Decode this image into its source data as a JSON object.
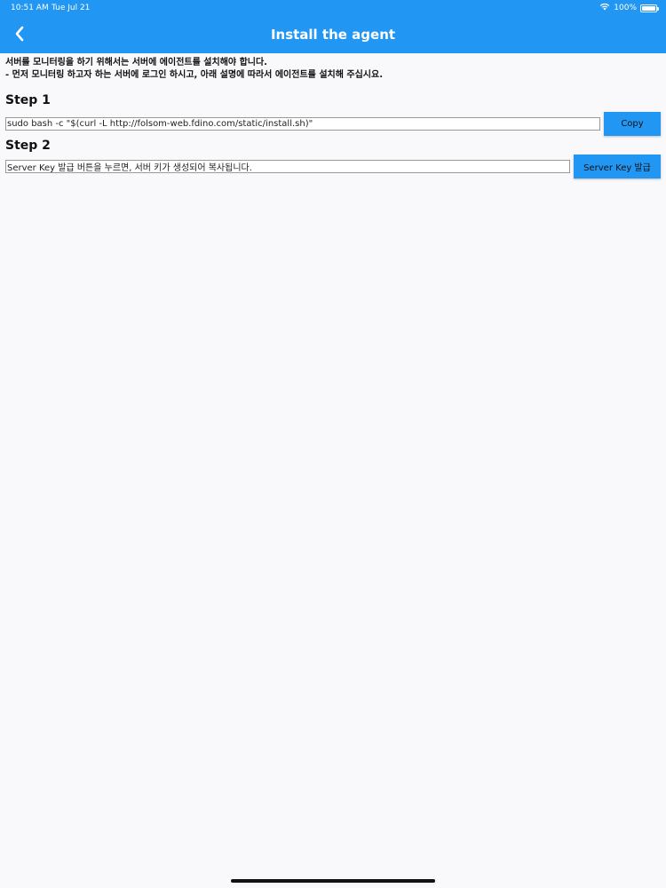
{
  "status_bar": {
    "time": "10:51 AM",
    "date": "Tue Jul 21",
    "battery_text": "100%",
    "wifi_icon": "wifi-icon",
    "battery_icon": "battery-icon"
  },
  "header": {
    "title": "Install the agent",
    "back_icon": "chevron-left-icon",
    "background_color": "#2196f3"
  },
  "intro": {
    "line1": "서버를 모니터링을 하기 위해서는 서버에 에이전트를 설치해야 합니다.",
    "line2": "- 먼저 모니터링 하고자 하는 서버에 로그인 하시고, 아래 설명에 따라서 에이전트를 설치해 주십시요."
  },
  "step1": {
    "title": "Step 1",
    "command_value": "sudo bash -c \"$(curl -L http://folsom-web.fdino.com/static/install.sh)\"",
    "copy_label": "Copy"
  },
  "step2": {
    "title": "Step 2",
    "key_value": "Server Key 발급 버튼을 누르면, 서버 키가 생성되어 복사됩니다.",
    "issue_label": "Server Key 발급"
  }
}
